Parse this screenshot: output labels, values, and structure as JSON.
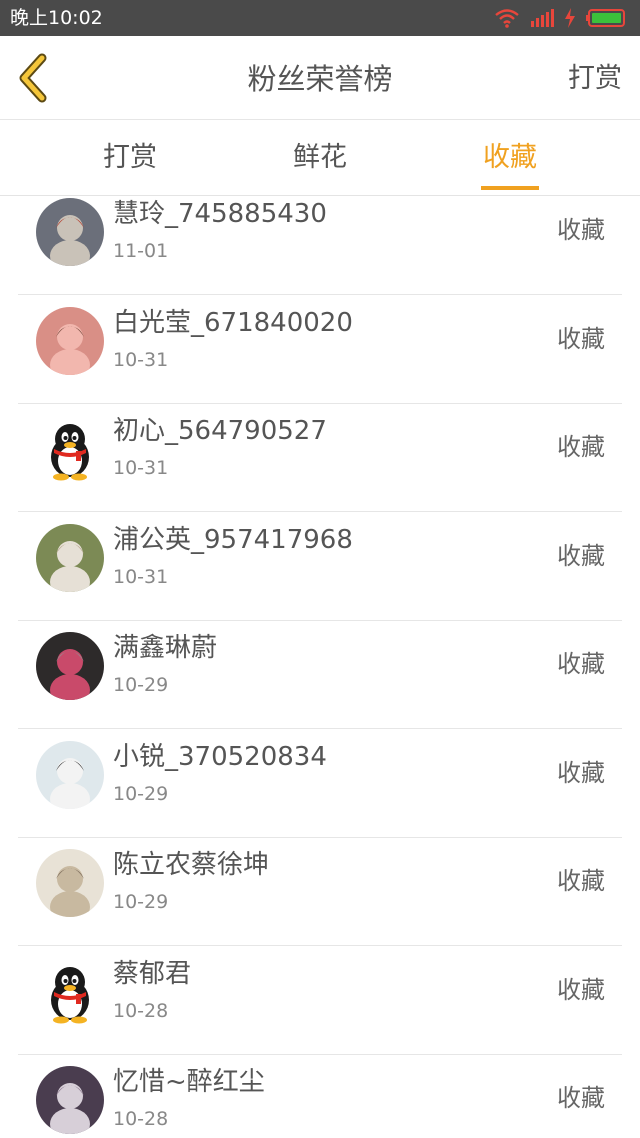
{
  "status_bar": {
    "time": "晚上10:02",
    "icons": [
      "wifi-icon",
      "signal-icon",
      "charging-icon",
      "battery-icon"
    ],
    "colors": {
      "background": "#4a4a4a",
      "alert": "#e8463b",
      "battery": "#3cc13b"
    }
  },
  "header": {
    "back_icon": "chevron-left-icon",
    "title": "粉丝荣誉榜",
    "action_label": "打赏"
  },
  "tabs": [
    {
      "label": "打赏",
      "active": false
    },
    {
      "label": "鲜花",
      "active": false
    },
    {
      "label": "收藏",
      "active": true
    }
  ],
  "accent_color": "#f0a120",
  "list": {
    "items": [
      {
        "name": "慧玲_745885430",
        "date": "11-01",
        "action": "收藏",
        "avatar": "photo-avatar"
      },
      {
        "name": "白光莹_671840020",
        "date": "10-31",
        "action": "收藏",
        "avatar": "photo-avatar"
      },
      {
        "name": "初心_564790527",
        "date": "10-31",
        "action": "收藏",
        "avatar": "penguin-avatar"
      },
      {
        "name": "浦公英_957417968",
        "date": "10-31",
        "action": "收藏",
        "avatar": "photo-avatar"
      },
      {
        "name": "满鑫琳蔚",
        "date": "10-29",
        "action": "收藏",
        "avatar": "photo-avatar"
      },
      {
        "name": "小锐_370520834",
        "date": "10-29",
        "action": "收藏",
        "avatar": "photo-avatar"
      },
      {
        "name": "陈立农蔡徐坤",
        "date": "10-29",
        "action": "收藏",
        "avatar": "photo-avatar"
      },
      {
        "name": "蔡郁君",
        "date": "10-28",
        "action": "收藏",
        "avatar": "penguin-avatar"
      },
      {
        "name": "忆惜~醉红尘",
        "date": "10-28",
        "action": "收藏",
        "avatar": "photo-avatar"
      }
    ]
  }
}
